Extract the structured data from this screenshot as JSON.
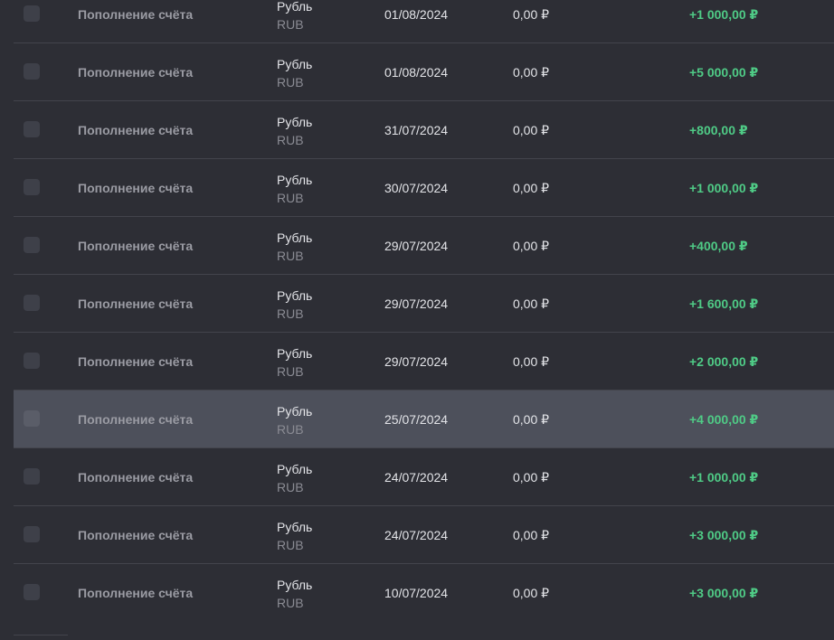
{
  "colors": {
    "background": "#2d2e35",
    "highlight_row": "#4d505b",
    "divider": "#43444c",
    "amount_positive": "#4fcb86"
  },
  "transactions": [
    {
      "type": "Пополнение счёта",
      "currency_name": "Рубль",
      "currency_code": "RUB",
      "date": "01/08/2024",
      "fee": "0,00 ₽",
      "amount": "+1 000,00 ₽"
    },
    {
      "type": "Пополнение счёта",
      "currency_name": "Рубль",
      "currency_code": "RUB",
      "date": "01/08/2024",
      "fee": "0,00 ₽",
      "amount": "+5 000,00 ₽"
    },
    {
      "type": "Пополнение счёта",
      "currency_name": "Рубль",
      "currency_code": "RUB",
      "date": "31/07/2024",
      "fee": "0,00 ₽",
      "amount": "+800,00 ₽"
    },
    {
      "type": "Пополнение счёта",
      "currency_name": "Рубль",
      "currency_code": "RUB",
      "date": "30/07/2024",
      "fee": "0,00 ₽",
      "amount": "+1 000,00 ₽"
    },
    {
      "type": "Пополнение счёта",
      "currency_name": "Рубль",
      "currency_code": "RUB",
      "date": "29/07/2024",
      "fee": "0,00 ₽",
      "amount": "+400,00 ₽"
    },
    {
      "type": "Пополнение счёта",
      "currency_name": "Рубль",
      "currency_code": "RUB",
      "date": "29/07/2024",
      "fee": "0,00 ₽",
      "amount": "+1 600,00 ₽"
    },
    {
      "type": "Пополнение счёта",
      "currency_name": "Рубль",
      "currency_code": "RUB",
      "date": "29/07/2024",
      "fee": "0,00 ₽",
      "amount": "+2 000,00 ₽"
    },
    {
      "type": "Пополнение счёта",
      "currency_name": "Рубль",
      "currency_code": "RUB",
      "date": "25/07/2024",
      "fee": "0,00 ₽",
      "amount": "+4 000,00 ₽",
      "highlighted": true
    },
    {
      "type": "Пополнение счёта",
      "currency_name": "Рубль",
      "currency_code": "RUB",
      "date": "24/07/2024",
      "fee": "0,00 ₽",
      "amount": "+1 000,00 ₽"
    },
    {
      "type": "Пополнение счёта",
      "currency_name": "Рубль",
      "currency_code": "RUB",
      "date": "24/07/2024",
      "fee": "0,00 ₽",
      "amount": "+3 000,00 ₽"
    },
    {
      "type": "Пополнение счёта",
      "currency_name": "Рубль",
      "currency_code": "RUB",
      "date": "10/07/2024",
      "fee": "0,00 ₽",
      "amount": "+3 000,00 ₽"
    }
  ]
}
